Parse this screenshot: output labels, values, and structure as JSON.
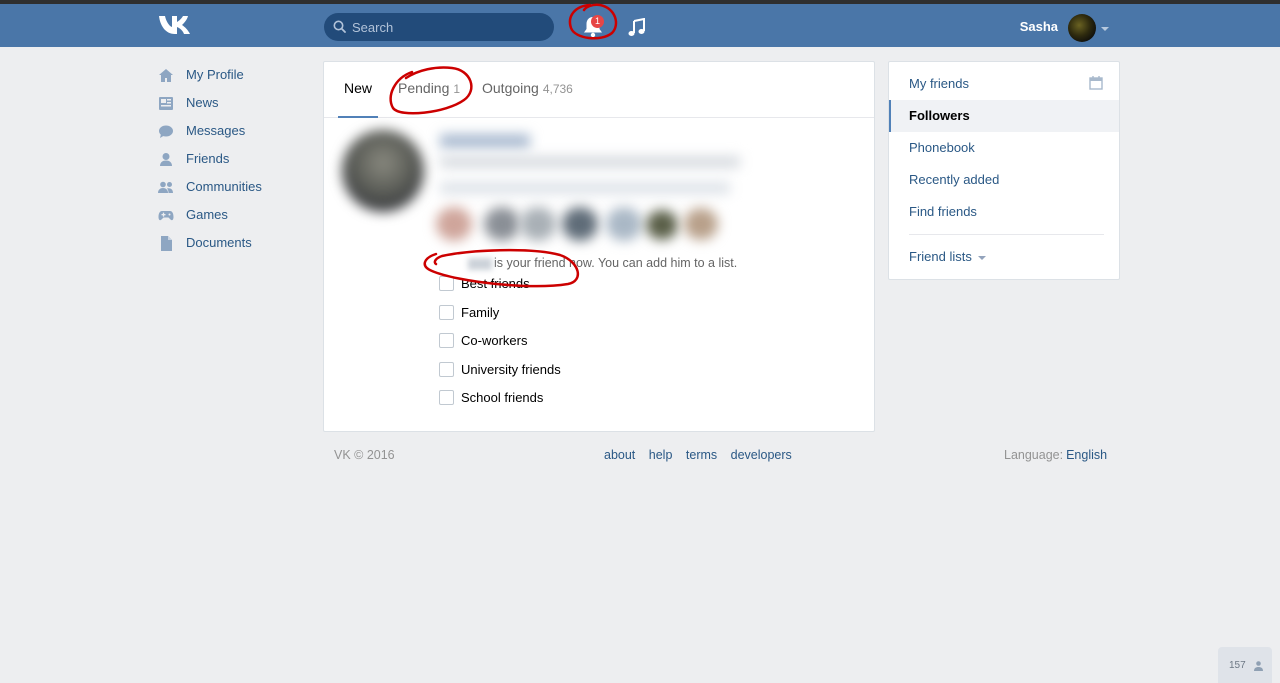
{
  "header": {
    "search_placeholder": "Search",
    "notification_count": "1",
    "user_name": "Sasha"
  },
  "left_nav": [
    {
      "label": "My Profile",
      "icon": "home-icon"
    },
    {
      "label": "News",
      "icon": "news-icon"
    },
    {
      "label": "Messages",
      "icon": "messages-icon"
    },
    {
      "label": "Friends",
      "icon": "friend-icon"
    },
    {
      "label": "Communities",
      "icon": "communities-icon"
    },
    {
      "label": "Games",
      "icon": "gamepad-icon"
    },
    {
      "label": "Documents",
      "icon": "document-icon"
    }
  ],
  "tabs": [
    {
      "label": "New",
      "count": "",
      "active": true
    },
    {
      "label": "Pending",
      "count": "1",
      "active": false
    },
    {
      "label": "Outgoing",
      "count": "4,736",
      "active": false
    }
  ],
  "friend_notice": "is your friend now. You can add him to a list.",
  "friend_lists": [
    "Best friends",
    "Family",
    "Co-workers",
    "University friends",
    "School friends"
  ],
  "right_menu": {
    "items": [
      "My friends",
      "Followers",
      "Phonebook",
      "Recently added",
      "Find friends"
    ],
    "selected": "Followers",
    "friend_lists_label": "Friend lists"
  },
  "footer": {
    "copyright": "VK © 2016",
    "links": [
      "about",
      "help",
      "terms",
      "developers"
    ],
    "language_label": "Language:",
    "language_value": "English"
  },
  "online_count": "157",
  "colors": {
    "header": "#4a76a8",
    "link": "#2a5885",
    "background": "#edeef0",
    "badge": "#e64646",
    "annotation": "#cc0000"
  }
}
